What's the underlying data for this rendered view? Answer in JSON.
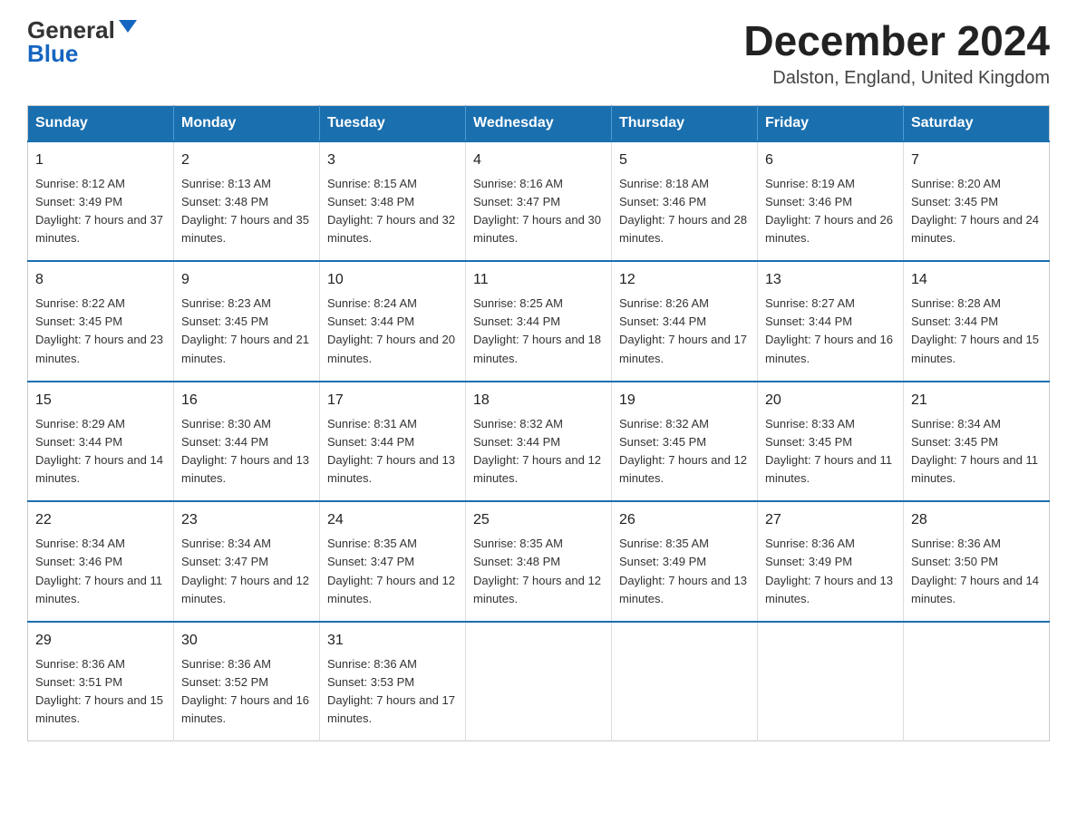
{
  "logo": {
    "general": "General",
    "blue": "Blue"
  },
  "title": "December 2024",
  "location": "Dalston, England, United Kingdom",
  "days_of_week": [
    "Sunday",
    "Monday",
    "Tuesday",
    "Wednesday",
    "Thursday",
    "Friday",
    "Saturday"
  ],
  "weeks": [
    [
      {
        "day": "1",
        "sunrise": "Sunrise: 8:12 AM",
        "sunset": "Sunset: 3:49 PM",
        "daylight": "Daylight: 7 hours and 37 minutes."
      },
      {
        "day": "2",
        "sunrise": "Sunrise: 8:13 AM",
        "sunset": "Sunset: 3:48 PM",
        "daylight": "Daylight: 7 hours and 35 minutes."
      },
      {
        "day": "3",
        "sunrise": "Sunrise: 8:15 AM",
        "sunset": "Sunset: 3:48 PM",
        "daylight": "Daylight: 7 hours and 32 minutes."
      },
      {
        "day": "4",
        "sunrise": "Sunrise: 8:16 AM",
        "sunset": "Sunset: 3:47 PM",
        "daylight": "Daylight: 7 hours and 30 minutes."
      },
      {
        "day": "5",
        "sunrise": "Sunrise: 8:18 AM",
        "sunset": "Sunset: 3:46 PM",
        "daylight": "Daylight: 7 hours and 28 minutes."
      },
      {
        "day": "6",
        "sunrise": "Sunrise: 8:19 AM",
        "sunset": "Sunset: 3:46 PM",
        "daylight": "Daylight: 7 hours and 26 minutes."
      },
      {
        "day": "7",
        "sunrise": "Sunrise: 8:20 AM",
        "sunset": "Sunset: 3:45 PM",
        "daylight": "Daylight: 7 hours and 24 minutes."
      }
    ],
    [
      {
        "day": "8",
        "sunrise": "Sunrise: 8:22 AM",
        "sunset": "Sunset: 3:45 PM",
        "daylight": "Daylight: 7 hours and 23 minutes."
      },
      {
        "day": "9",
        "sunrise": "Sunrise: 8:23 AM",
        "sunset": "Sunset: 3:45 PM",
        "daylight": "Daylight: 7 hours and 21 minutes."
      },
      {
        "day": "10",
        "sunrise": "Sunrise: 8:24 AM",
        "sunset": "Sunset: 3:44 PM",
        "daylight": "Daylight: 7 hours and 20 minutes."
      },
      {
        "day": "11",
        "sunrise": "Sunrise: 8:25 AM",
        "sunset": "Sunset: 3:44 PM",
        "daylight": "Daylight: 7 hours and 18 minutes."
      },
      {
        "day": "12",
        "sunrise": "Sunrise: 8:26 AM",
        "sunset": "Sunset: 3:44 PM",
        "daylight": "Daylight: 7 hours and 17 minutes."
      },
      {
        "day": "13",
        "sunrise": "Sunrise: 8:27 AM",
        "sunset": "Sunset: 3:44 PM",
        "daylight": "Daylight: 7 hours and 16 minutes."
      },
      {
        "day": "14",
        "sunrise": "Sunrise: 8:28 AM",
        "sunset": "Sunset: 3:44 PM",
        "daylight": "Daylight: 7 hours and 15 minutes."
      }
    ],
    [
      {
        "day": "15",
        "sunrise": "Sunrise: 8:29 AM",
        "sunset": "Sunset: 3:44 PM",
        "daylight": "Daylight: 7 hours and 14 minutes."
      },
      {
        "day": "16",
        "sunrise": "Sunrise: 8:30 AM",
        "sunset": "Sunset: 3:44 PM",
        "daylight": "Daylight: 7 hours and 13 minutes."
      },
      {
        "day": "17",
        "sunrise": "Sunrise: 8:31 AM",
        "sunset": "Sunset: 3:44 PM",
        "daylight": "Daylight: 7 hours and 13 minutes."
      },
      {
        "day": "18",
        "sunrise": "Sunrise: 8:32 AM",
        "sunset": "Sunset: 3:44 PM",
        "daylight": "Daylight: 7 hours and 12 minutes."
      },
      {
        "day": "19",
        "sunrise": "Sunrise: 8:32 AM",
        "sunset": "Sunset: 3:45 PM",
        "daylight": "Daylight: 7 hours and 12 minutes."
      },
      {
        "day": "20",
        "sunrise": "Sunrise: 8:33 AM",
        "sunset": "Sunset: 3:45 PM",
        "daylight": "Daylight: 7 hours and 11 minutes."
      },
      {
        "day": "21",
        "sunrise": "Sunrise: 8:34 AM",
        "sunset": "Sunset: 3:45 PM",
        "daylight": "Daylight: 7 hours and 11 minutes."
      }
    ],
    [
      {
        "day": "22",
        "sunrise": "Sunrise: 8:34 AM",
        "sunset": "Sunset: 3:46 PM",
        "daylight": "Daylight: 7 hours and 11 minutes."
      },
      {
        "day": "23",
        "sunrise": "Sunrise: 8:34 AM",
        "sunset": "Sunset: 3:47 PM",
        "daylight": "Daylight: 7 hours and 12 minutes."
      },
      {
        "day": "24",
        "sunrise": "Sunrise: 8:35 AM",
        "sunset": "Sunset: 3:47 PM",
        "daylight": "Daylight: 7 hours and 12 minutes."
      },
      {
        "day": "25",
        "sunrise": "Sunrise: 8:35 AM",
        "sunset": "Sunset: 3:48 PM",
        "daylight": "Daylight: 7 hours and 12 minutes."
      },
      {
        "day": "26",
        "sunrise": "Sunrise: 8:35 AM",
        "sunset": "Sunset: 3:49 PM",
        "daylight": "Daylight: 7 hours and 13 minutes."
      },
      {
        "day": "27",
        "sunrise": "Sunrise: 8:36 AM",
        "sunset": "Sunset: 3:49 PM",
        "daylight": "Daylight: 7 hours and 13 minutes."
      },
      {
        "day": "28",
        "sunrise": "Sunrise: 8:36 AM",
        "sunset": "Sunset: 3:50 PM",
        "daylight": "Daylight: 7 hours and 14 minutes."
      }
    ],
    [
      {
        "day": "29",
        "sunrise": "Sunrise: 8:36 AM",
        "sunset": "Sunset: 3:51 PM",
        "daylight": "Daylight: 7 hours and 15 minutes."
      },
      {
        "day": "30",
        "sunrise": "Sunrise: 8:36 AM",
        "sunset": "Sunset: 3:52 PM",
        "daylight": "Daylight: 7 hours and 16 minutes."
      },
      {
        "day": "31",
        "sunrise": "Sunrise: 8:36 AM",
        "sunset": "Sunset: 3:53 PM",
        "daylight": "Daylight: 7 hours and 17 minutes."
      },
      null,
      null,
      null,
      null
    ]
  ]
}
